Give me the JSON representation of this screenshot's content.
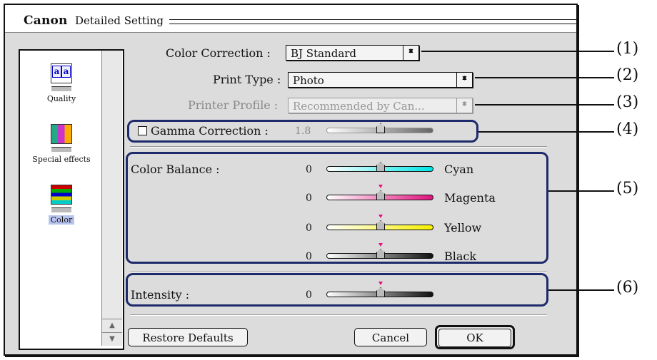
{
  "window": {
    "brand": "Canon",
    "title": "Detailed Setting"
  },
  "sidebar": {
    "items": [
      {
        "label": "Quality",
        "icon": "quality-icon"
      },
      {
        "label": "Special effects",
        "icon": "special-effects-icon"
      },
      {
        "label": "Color",
        "icon": "color-icon",
        "selected": true
      }
    ]
  },
  "settings": {
    "color_correction": {
      "label": "Color Correction :",
      "value": "BJ Standard"
    },
    "print_type": {
      "label": "Print Type :",
      "value": "Photo"
    },
    "printer_profile": {
      "label": "Printer Profile :",
      "value": "Recommended by Can...",
      "enabled": false
    },
    "gamma": {
      "label": "Gamma Correction :",
      "value": "1.8",
      "checked": false
    }
  },
  "color_balance": {
    "label": "Color Balance :",
    "channels": [
      {
        "name": "Cyan",
        "value": "0",
        "color": "#00e5e5"
      },
      {
        "name": "Magenta",
        "value": "0",
        "color": "#e0147e"
      },
      {
        "name": "Yellow",
        "value": "0",
        "color": "#f5f000"
      },
      {
        "name": "Black",
        "value": "0",
        "color": "#111111"
      }
    ]
  },
  "intensity": {
    "label": "Intensity :",
    "value": "0"
  },
  "buttons": {
    "restore": "Restore Defaults",
    "cancel": "Cancel",
    "ok": "OK"
  },
  "callouts": [
    "(1)",
    "(2)",
    "(3)",
    "(4)",
    "(5)",
    "(6)"
  ],
  "colors": {
    "highlight": "#1d2a6b",
    "selection": "#b8c4f0"
  }
}
